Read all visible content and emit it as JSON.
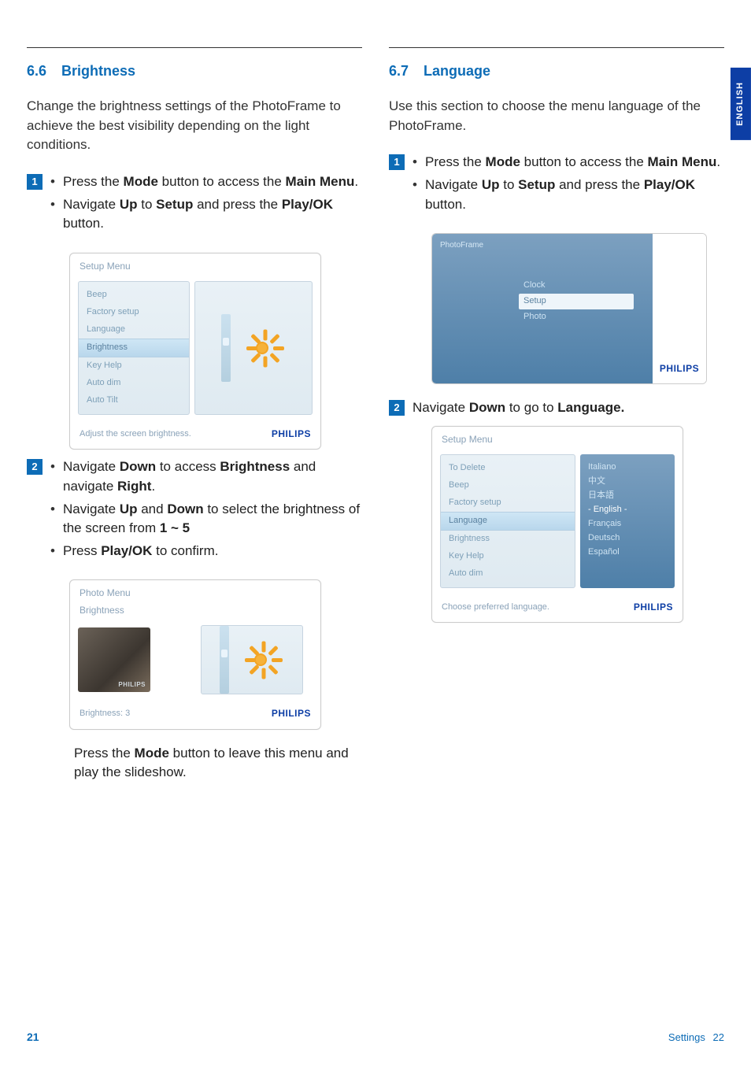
{
  "sideTab": "ENGLISH",
  "left": {
    "heading_num": "6.6",
    "heading_title": "Brightness",
    "intro": "Change the brightness settings of the PhotoFrame to achieve the best visibility depending on the light conditions.",
    "step1": {
      "bullets": [
        "Press the <b>Mode</b> button to access the <b>Main Menu</b>.",
        "Navigate <b>Up</b> to <b>Setup</b> and press the <b>Play/OK</b> button."
      ]
    },
    "panel1": {
      "title": "Setup Menu",
      "items": [
        "Beep",
        "Factory setup",
        "Language",
        "Brightness",
        "Key Help",
        "Auto dim",
        "Auto Tilt"
      ],
      "selectedIndex": 3,
      "footer": "Adjust the screen brightness.",
      "brand": "PHILIPS"
    },
    "step2": {
      "bullets": [
        "Navigate <b>Down</b> to access <b>Brightness</b> and navigate <b>Right</b>.",
        "Navigate <b>Up</b> and <b>Down</b> to select the brightness of the screen from <b>1 ~ 5</b>",
        "Press <b>Play/OK</b> to confirm."
      ]
    },
    "panel2": {
      "title1": "Photo Menu",
      "title2": "Brightness",
      "footer": "Brightness: 3",
      "brand": "PHILIPS"
    },
    "tail": "Press the <b>Mode</b> button to leave this menu and play the slideshow."
  },
  "right": {
    "heading_num": "6.7",
    "heading_title": "Language",
    "intro": "Use this section to choose the menu language of the PhotoFrame.",
    "step1": {
      "bullets": [
        "Press the <b>Mode</b> button to access the <b>Main Menu</b>.",
        "Navigate <b>Up</b> to <b>Setup</b> and press the <b>Play/OK</b> button."
      ]
    },
    "modePanel": {
      "header": "PhotoFrame",
      "rows": [
        "Clock",
        "Setup",
        "Photo"
      ],
      "selectedIndex": 1,
      "brand": "PHILIPS"
    },
    "step2_line": "Navigate <b>Down</b> to go to <b>Language.</b>",
    "panel2": {
      "title": "Setup Menu",
      "items": [
        "To Delete",
        "Beep",
        "Factory setup",
        "Language",
        "Brightness",
        "Key Help",
        "Auto dim"
      ],
      "selectedIndex": 3,
      "langs": [
        "Italiano",
        "中文",
        "日本語",
        "- English -",
        "Français",
        "Deutsch",
        "Español"
      ],
      "langSelectedIndex": 3,
      "footer": "Choose preferred language.",
      "brand": "PHILIPS"
    }
  },
  "footer": {
    "left": "21",
    "right_pn": "22",
    "right_label": "Settings"
  }
}
